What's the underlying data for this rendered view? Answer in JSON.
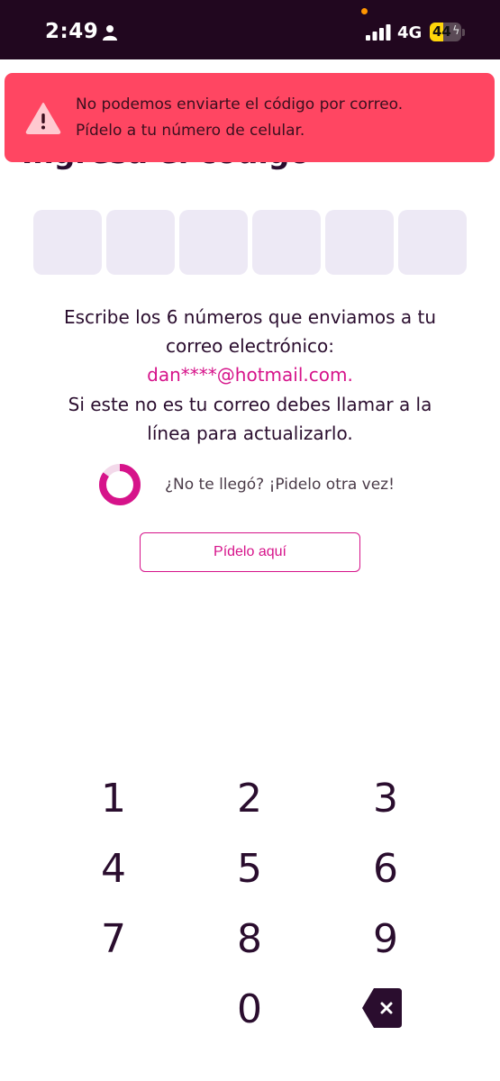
{
  "status_bar": {
    "time": "2:49",
    "network": "4G",
    "battery": "44",
    "battery_level": 0.44,
    "icons": [
      "person-icon",
      "signal-icon",
      "battery-icon",
      "charging-bolt-icon"
    ]
  },
  "page": {
    "title": "Ingresa el código"
  },
  "error_toast": {
    "line1": "No podemos enviarte el código por correo.",
    "line2": "Pídelo a tu número de celular.",
    "icon": "warning-icon",
    "color": "#ff4662"
  },
  "code_inputs": [
    "",
    "",
    "",
    "",
    "",
    ""
  ],
  "instructions": {
    "line1": "Escribe los 6 números que enviamos a tu",
    "line2": "correo electrónico:",
    "email": "dan****@hotmail.com.",
    "line3": "Si este no es tu correo debes llamar a la",
    "line4": "línea para actualizarlo."
  },
  "resend": {
    "prompt": "¿No te llegó? ¡Pidelo otra vez!",
    "button_label": "Pídelo aquí",
    "timer_remaining": 0.85
  },
  "keypad": {
    "keys": [
      "1",
      "2",
      "3",
      "4",
      "5",
      "6",
      "7",
      "8",
      "9",
      "0"
    ],
    "delete_icon": "backspace-icon"
  },
  "colors": {
    "accent": "#d6138a",
    "status_bar": "#21071f",
    "code_box": "#ede9f5",
    "text": "#2a0d2e"
  }
}
